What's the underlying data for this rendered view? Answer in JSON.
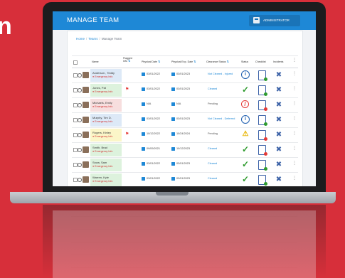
{
  "side_text": "n",
  "header": {
    "title": "MANAGE TEAM",
    "role": "ADMINISTRATOR",
    "role_icon": "id-card-icon"
  },
  "breadcrumb": [
    "Home",
    "Teams",
    "Manage Team"
  ],
  "columns": [
    "Name",
    "Flagged Info",
    "Physical Date",
    "Physical Exp. Date",
    "Clearance Status",
    "Status",
    "Checklist",
    "Incidents"
  ],
  "rows": [
    {
      "name": "Anderson , Teddy",
      "emergency": "Emergency Info",
      "flagged": false,
      "physical": "03/01/2022",
      "physical_exp": "03/01/2023",
      "clearance": "Not Cleared - Injured",
      "clearance_color": "#1e88d6",
      "status": "info-circle-icon",
      "checklist": "green",
      "name_bg": "#dde9f7"
    },
    {
      "name": "Jones, Pat",
      "emergency": "Emergency Info",
      "flagged": true,
      "physical": "03/01/2022",
      "physical_exp": "03/01/2023",
      "clearance": "Cleared",
      "clearance_color": "#1e88d6",
      "status": "check-icon",
      "checklist": "green",
      "name_bg": "#ddf2dd"
    },
    {
      "name": "Michaels, Emily",
      "emergency": "Emergency Info",
      "flagged": false,
      "physical": "N/A",
      "physical_exp": "N/A",
      "clearance": "Pending",
      "clearance_color": "#555555",
      "status": "ban-icon",
      "checklist": "red",
      "name_bg": "#f7dede"
    },
    {
      "name": "Murphy, Tim D.",
      "emergency": "Emergency Info",
      "flagged": false,
      "physical": "03/01/2022",
      "physical_exp": "03/01/2023",
      "clearance": "Not Cleared - Deferred",
      "clearance_color": "#1e88d6",
      "status": "info-circle-icon",
      "checklist": "green",
      "name_bg": "#dde9f7"
    },
    {
      "name": "Rogers, Kinley",
      "emergency": "Emergency Info",
      "flagged": true,
      "physical": "10/12/2022",
      "physical_exp": "10/24/2024",
      "clearance": "Pending",
      "clearance_color": "#555555",
      "status": "warning-icon",
      "checklist": "red",
      "name_bg": "#fbf6c8"
    },
    {
      "name": "Smith, Brad",
      "emergency": "Emergency Info",
      "flagged": false,
      "physical": "09/09/2021",
      "physical_exp": "10/12/2023",
      "clearance": "Cleared",
      "clearance_color": "#1e88d6",
      "status": "check-icon",
      "checklist": "red",
      "name_bg": "#ddf2dd"
    },
    {
      "name": "Snow, Sam",
      "emergency": "Emergency Info",
      "flagged": false,
      "physical": "03/01/2022",
      "physical_exp": "03/01/2023",
      "clearance": "Cleared",
      "clearance_color": "#1e88d6",
      "status": "check-icon",
      "checklist": "green",
      "name_bg": "#ddf2dd"
    },
    {
      "name": "Warren, Kyle",
      "emergency": "Emergency Info",
      "flagged": false,
      "physical": "03/01/2022",
      "physical_exp": "03/01/2023",
      "clearance": "Cleared",
      "clearance_color": "#1e88d6",
      "status": "check-icon",
      "checklist": "green",
      "name_bg": "#ddf2dd"
    }
  ],
  "colors": {
    "background": "#d72f3a",
    "header": "#1e88d6"
  }
}
